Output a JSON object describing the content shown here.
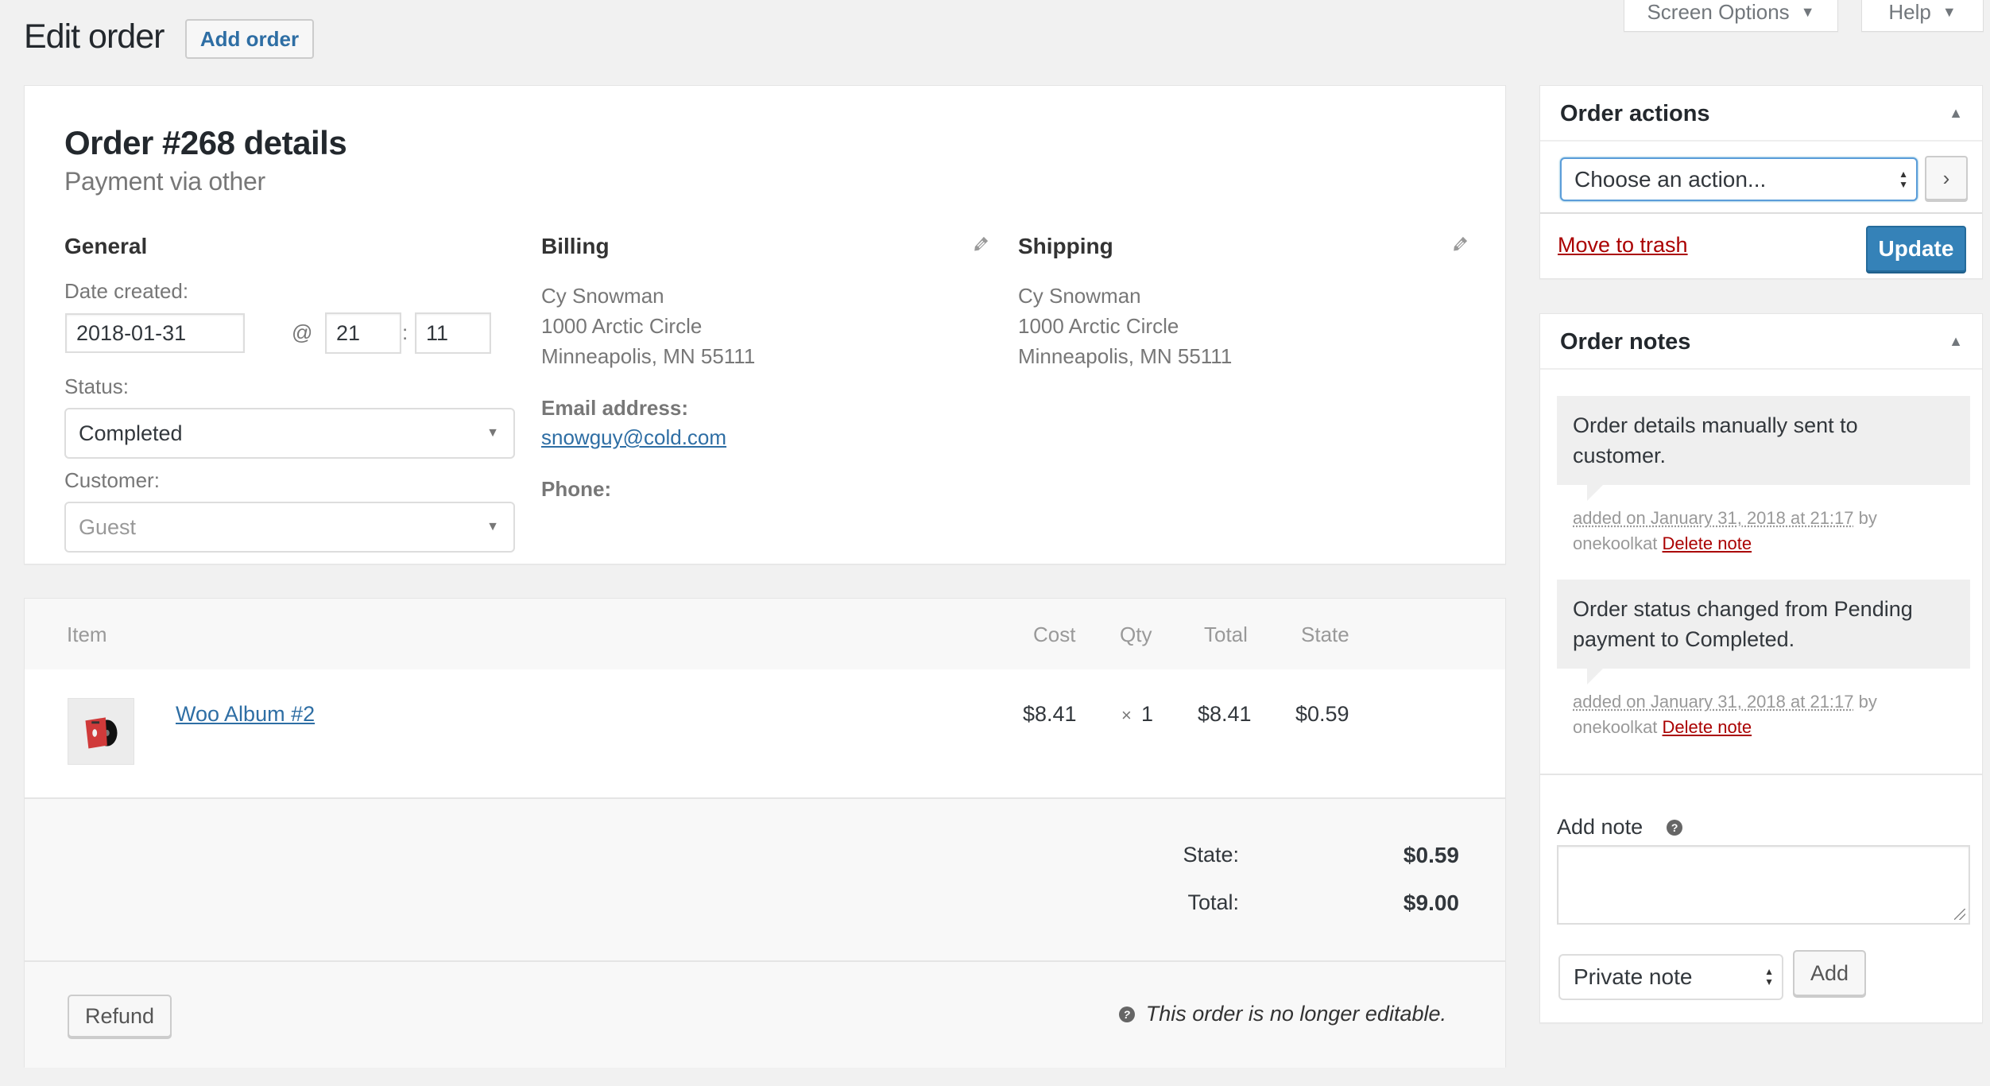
{
  "screen_meta": {
    "screen_options_label": "Screen Options",
    "help_label": "Help"
  },
  "header": {
    "title": "Edit order",
    "add_order_label": "Add order"
  },
  "order": {
    "heading": "Order #268 details",
    "payment_via": "Payment via other",
    "general": {
      "title": "General",
      "date_created_label": "Date created:",
      "date_value": "2018-01-31",
      "at_symbol": "@",
      "hour_value": "21",
      "time_separator": ":",
      "minute_value": "11",
      "status_label": "Status:",
      "status_value": "Completed",
      "customer_label": "Customer:",
      "customer_value": "Guest"
    },
    "billing": {
      "title": "Billing",
      "name": "Cy Snowman",
      "address_line1": "1000 Arctic Circle",
      "city_line": "Minneapolis, MN 55111",
      "email_label": "Email address:",
      "email": "snowguy@cold.com",
      "phone_label": "Phone:"
    },
    "shipping": {
      "title": "Shipping",
      "name": "Cy Snowman",
      "address_line1": "1000 Arctic Circle",
      "city_line": "Minneapolis, MN 55111"
    }
  },
  "items": {
    "columns": {
      "item": "Item",
      "cost": "Cost",
      "qty": "Qty",
      "total": "Total",
      "state": "State"
    },
    "rows": [
      {
        "name": "Woo Album #2",
        "cost": "$8.41",
        "qty_prefix": "×",
        "qty": "1",
        "total": "$8.41",
        "state": "$0.59"
      }
    ],
    "totals": {
      "state_label": "State:",
      "state_value": "$0.59",
      "total_label": "Total:",
      "total_value": "$9.00"
    },
    "refund_label": "Refund",
    "not_editable_text": "This order is no longer editable."
  },
  "order_actions": {
    "title": "Order actions",
    "select_value": "Choose an action...",
    "go_label": "›",
    "trash_label": "Move to trash",
    "update_label": "Update"
  },
  "order_notes": {
    "title": "Order notes",
    "notes": [
      {
        "content": "Order details manually sent to customer.",
        "date_text": "added on January 31, 2018 at 21:17",
        "by_text": "by",
        "author": "onekoolkat",
        "delete_label": "Delete note"
      },
      {
        "content": "Order status changed from Pending payment to Completed.",
        "date_text": "added on January 31, 2018 at 21:17",
        "by_text": "by",
        "author": "onekoolkat",
        "delete_label": "Delete note"
      }
    ],
    "add_note_label": "Add note",
    "note_textarea_value": "",
    "note_type_value": "Private note",
    "add_button_label": "Add"
  },
  "colors": {
    "link_blue": "#2e6ea4",
    "primary_button": "#3582b8",
    "danger_red": "#a00",
    "background": "#f1f1f1"
  }
}
